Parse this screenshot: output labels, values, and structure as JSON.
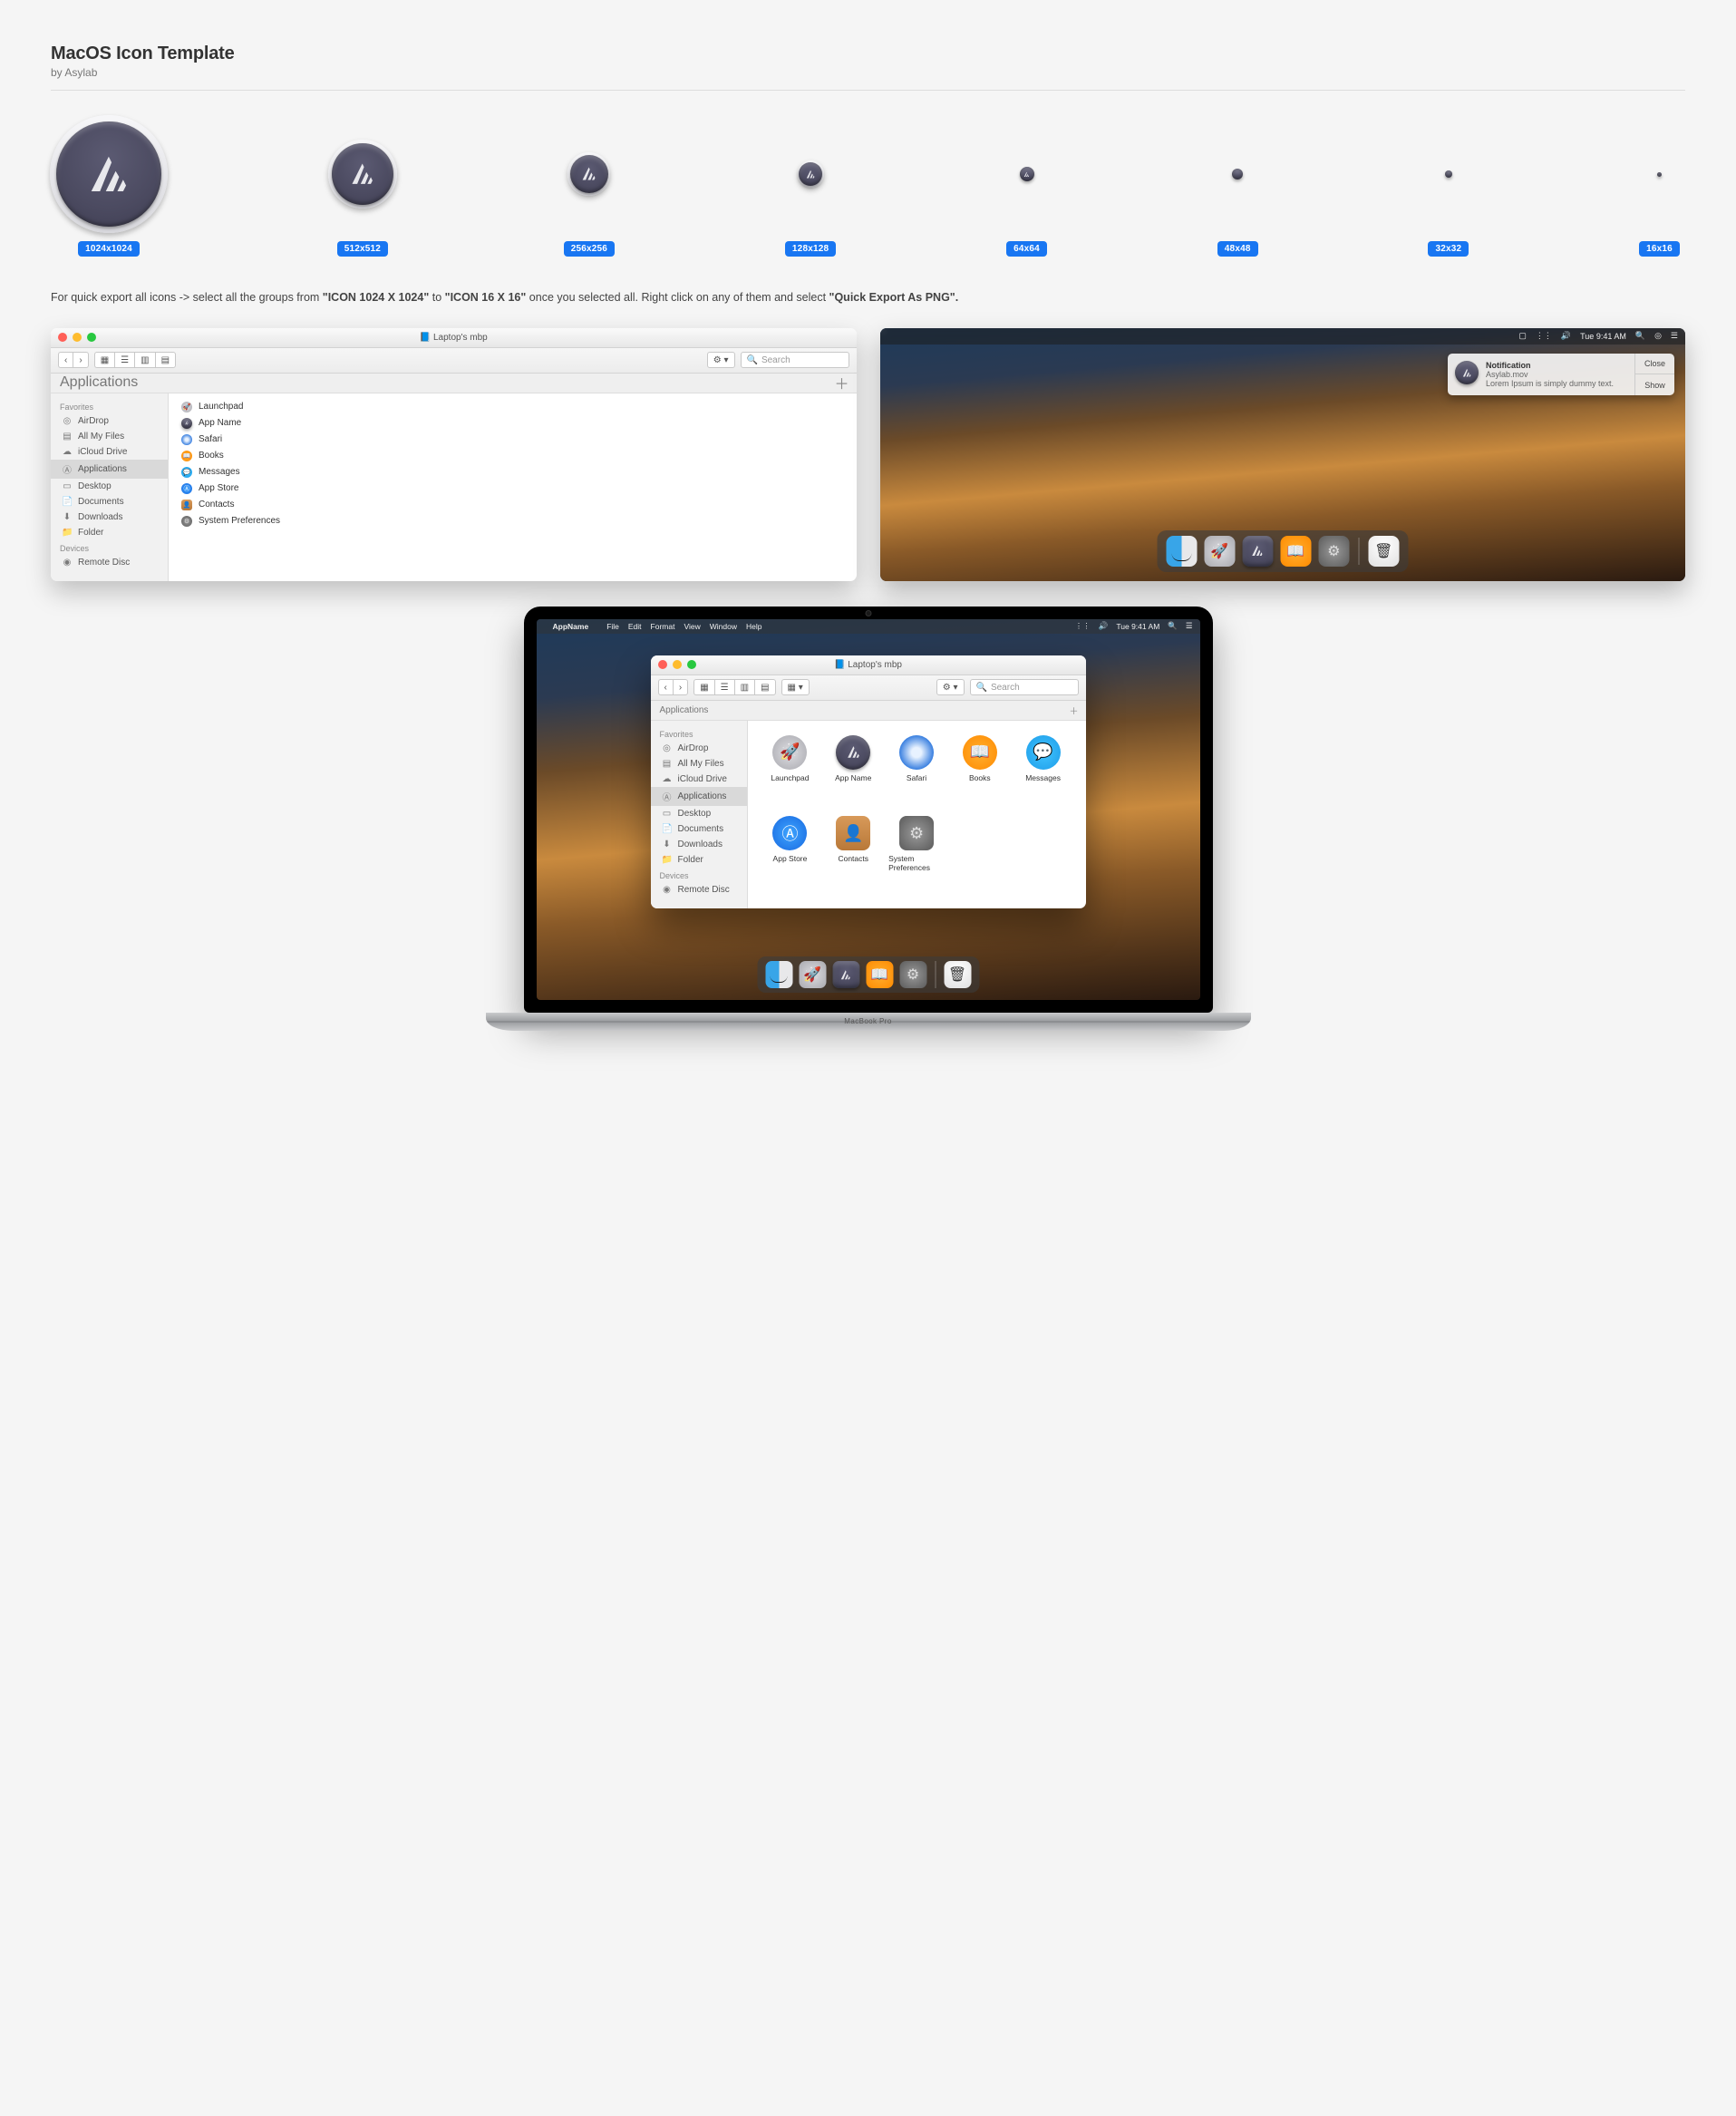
{
  "header": {
    "title": "MacOS Icon Template",
    "byline": "by Asylab"
  },
  "sizes": [
    "1024x1024",
    "512x512",
    "256x256",
    "128x128",
    "64x64",
    "48x48",
    "32x32",
    "16x16"
  ],
  "instruction": {
    "pre": "For quick export all icons -> select all the groups from ",
    "b1": "\"ICON 1024 X 1024\"",
    "mid1": " to ",
    "b2": "\"ICON 16 X 16\"",
    "mid2": " once you selected all. Right click on any of them and select ",
    "b3": "\"Quick Export As PNG\"."
  },
  "finder": {
    "window_title": "Laptop's mbp",
    "tab": "Applications",
    "search_placeholder": "Search",
    "sidebar": {
      "favorites_label": "Favorites",
      "devices_label": "Devices",
      "items": [
        "AirDrop",
        "All My Files",
        "iCloud Drive",
        "Applications",
        "Desktop",
        "Documents",
        "Downloads",
        "Folder"
      ],
      "device_items": [
        "Remote Disc"
      ]
    },
    "apps": [
      "Launchpad",
      "App Name",
      "Safari",
      "Books",
      "Messages",
      "App Store",
      "Contacts",
      "System Preferences"
    ]
  },
  "desktop": {
    "menubar_time": "Tue 9:41 AM",
    "notification": {
      "title": "Notification",
      "subtitle": "Asylab.mov",
      "body": "Lorem Ipsum is simply dummy text.",
      "close": "Close",
      "show": "Show"
    }
  },
  "laptop": {
    "label": "MacBook Pro",
    "menubar": {
      "app": "AppName",
      "items": [
        "File",
        "Edit",
        "Format",
        "View",
        "Window",
        "Help"
      ],
      "time": "Tue 9:41 AM"
    }
  }
}
